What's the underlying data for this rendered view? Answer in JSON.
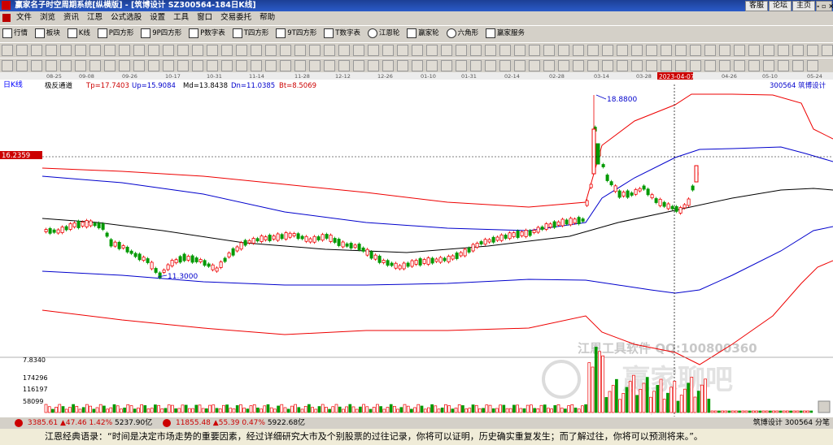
{
  "window": {
    "title": "赢家名子时空周期系统[纵横版] - [筑博设计  SZ300564-184日K线]",
    "right_buttons": [
      "客服",
      "论坛",
      "主页"
    ],
    "control": "- ▫ ×"
  },
  "menu": [
    "文件",
    "浏览",
    "资讯",
    "江恩",
    "公式选股",
    "设置",
    "工具",
    "窗口",
    "交易委托",
    "帮助"
  ],
  "toolbar1": [
    "行情",
    "板块",
    "K线",
    "P四方形",
    "9P四方形",
    "P数字表",
    "T四方形",
    "9T四方形",
    "T数字表",
    "江恩轮",
    "赢家轮",
    "六角形",
    "赢家服务"
  ],
  "chart": {
    "period_label": "日K线",
    "indicator_name": "极反通道",
    "tp": "Tp=17.7403",
    "up": "Up=15.9084",
    "md": "Md=13.8438",
    "dn": "Dn=11.0385",
    "bt": "Bt=8.5069",
    "stock_label": "300564  筑博设计",
    "date_ticks": [
      "08-25",
      "09-08",
      "09-26",
      "10-17",
      "10-31",
      "11-14",
      "11-28",
      "12-12",
      "12-26",
      "01-10",
      "01-31",
      "02-14",
      "02-28",
      "03-14",
      "03-28",
      "2023-04-07",
      "04-26",
      "05-10",
      "05-24"
    ],
    "price_tag": "16.2359",
    "high_label": "18.8800",
    "low_label": "11.3000",
    "vol_max": "7.8340",
    "vol_ticks": [
      "174296",
      "116197",
      "58099"
    ],
    "watermark1": "江恩工具软件 QQ:100800360",
    "watermark2": "赢家聊吧",
    "watermark3": "jiaoba.com"
  },
  "status": {
    "sh_index": "3385.61",
    "sh_change": "▲47.46",
    "sh_pct": "1.42%",
    "sh_amount": "5237.90亿",
    "sz_index": "11855.48",
    "sz_change": "▲55.39",
    "sz_pct": "0.47%",
    "sz_amount": "5922.68亿",
    "right_text": "筑博设计 300564 分笔"
  },
  "bottom": {
    "quote": "江恩经典语录：“时间是决定市场走势的重要因素，经过详细研究大市及个别股票的过往记录，你将可以证明，历史确实重复发生；而了解过往，你将可以预测将来。”。"
  },
  "colors": {
    "up": "#ff0000",
    "down": "#009900",
    "outer_band": "#ff0000",
    "inner_band": "#0000cc",
    "middle": "#000000"
  }
}
